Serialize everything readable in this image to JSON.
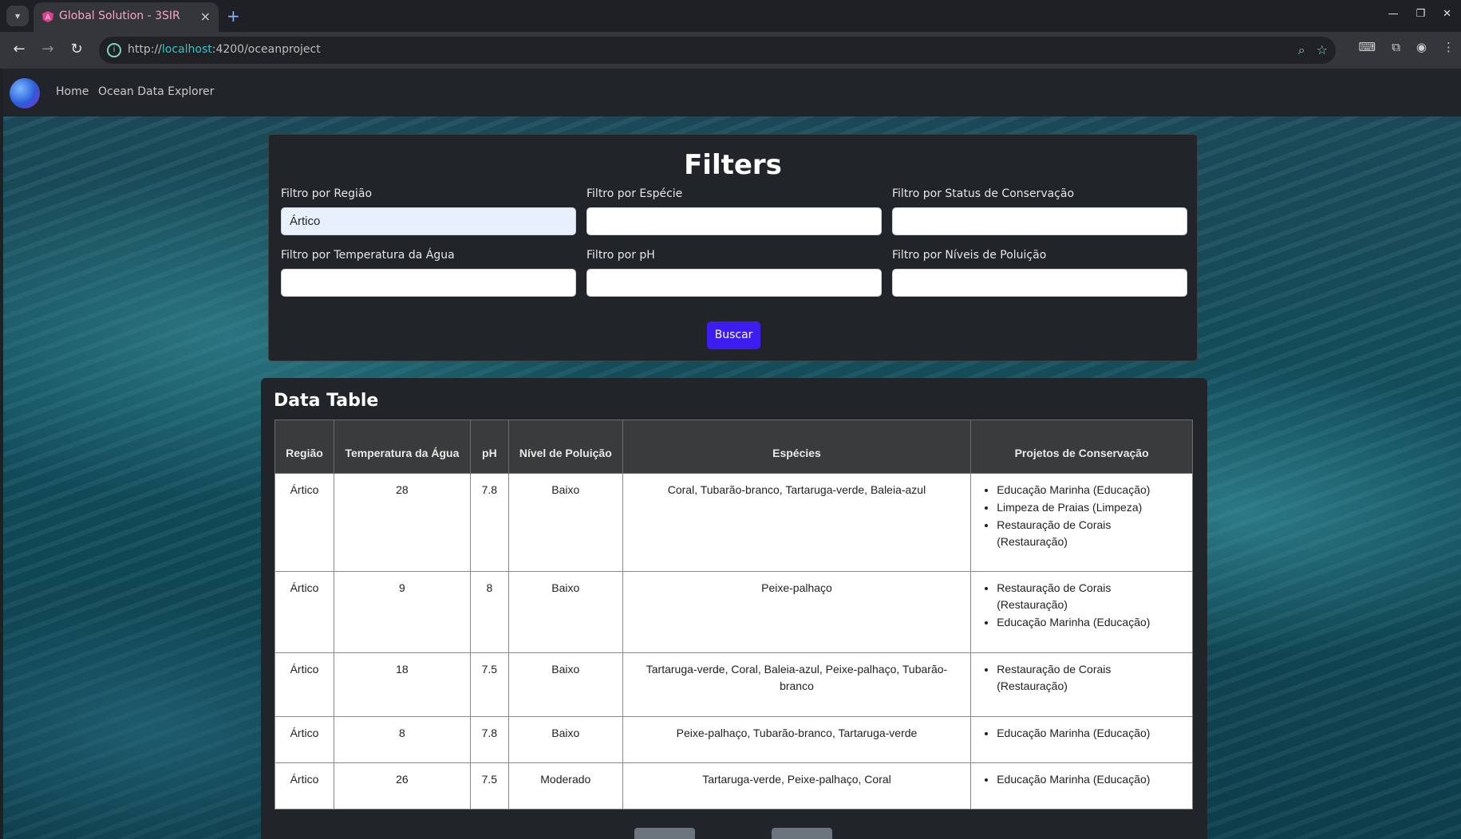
{
  "browser": {
    "tab_title": "Global Solution - 3SIR",
    "tab_close": "×",
    "new_tab": "+",
    "url_prefix": "http://",
    "url_host": "localhost",
    "url_rest": ":4200/oceanproject"
  },
  "navbar": {
    "links": [
      "Home",
      "Ocean Data Explorer"
    ]
  },
  "filters": {
    "title": "Filters",
    "fields": [
      {
        "label": "Filtro por Região",
        "value": "Ártico"
      },
      {
        "label": "Filtro por Espécie",
        "value": ""
      },
      {
        "label": "Filtro por Status de Conservação",
        "value": ""
      },
      {
        "label": "Filtro por Temperatura da Água",
        "value": ""
      },
      {
        "label": "Filtro por pH",
        "value": ""
      },
      {
        "label": "Filtro por Níveis de Poluição",
        "value": ""
      }
    ],
    "search_button": "Buscar"
  },
  "data_table": {
    "title": "Data Table",
    "headers": [
      "Região",
      "Temperatura da Água",
      "pH",
      "Nível de Poluição",
      "Espécies",
      "Projetos de Conservação"
    ],
    "rows": [
      {
        "regiao": "Ártico",
        "temp": "28",
        "ph": "7.8",
        "poluicao": "Baixo",
        "especies": "Coral, Tubarão-branco, Tartaruga-verde, Baleia-azul",
        "projetos": [
          "Educação Marinha (Educação)",
          "Limpeza de Praias (Limpeza)",
          "Restauração de Corais (Restauração)"
        ]
      },
      {
        "regiao": "Ártico",
        "temp": "9",
        "ph": "8",
        "poluicao": "Baixo",
        "especies": "Peixe-palhaço",
        "projetos": [
          "Restauração de Corais (Restauração)",
          "Educação Marinha (Educação)"
        ]
      },
      {
        "regiao": "Ártico",
        "temp": "18",
        "ph": "7.5",
        "poluicao": "Baixo",
        "especies": "Tartaruga-verde, Coral, Baleia-azul, Peixe-palhaço, Tubarão-branco",
        "projetos": [
          "Restauração de Corais (Restauração)"
        ]
      },
      {
        "regiao": "Ártico",
        "temp": "8",
        "ph": "7.8",
        "poluicao": "Baixo",
        "especies": "Peixe-palhaço, Tubarão-branco, Tartaruga-verde",
        "projetos": [
          "Educação Marinha (Educação)"
        ]
      },
      {
        "regiao": "Ártico",
        "temp": "26",
        "ph": "7.5",
        "poluicao": "Moderado",
        "especies": "Tartaruga-verde, Peixe-palhaço, Coral",
        "projetos": [
          "Educação Marinha (Educação)"
        ]
      }
    ]
  },
  "colors": {
    "accent_button": "#3d1cf0",
    "card_bg": "#212529",
    "tab_title": "#f3a6c9"
  }
}
